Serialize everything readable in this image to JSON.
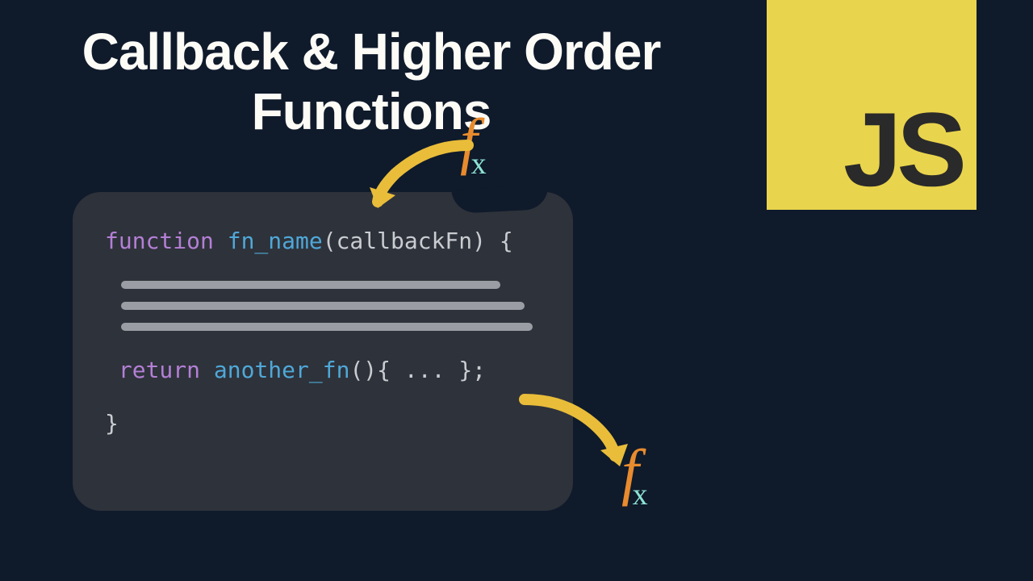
{
  "title": "Callback & Higher Order Functions",
  "badge": {
    "text": "JS"
  },
  "code": {
    "line1_kw": "function",
    "line1_fn": " fn_name",
    "line1_rest": "(callbackFn) {",
    "return_kw": " return",
    "return_fn": " another_fn",
    "return_rest": "(){ ... };",
    "close": "}"
  },
  "fx": {
    "f": "f",
    "x": "x"
  },
  "colors": {
    "background": "#0f1a2b",
    "code_bg": "#2e323a",
    "badge_bg": "#e9d44d",
    "accent_orange": "#e88b2e",
    "accent_teal": "#8de4d4",
    "arrow": "#e9bd3a"
  }
}
